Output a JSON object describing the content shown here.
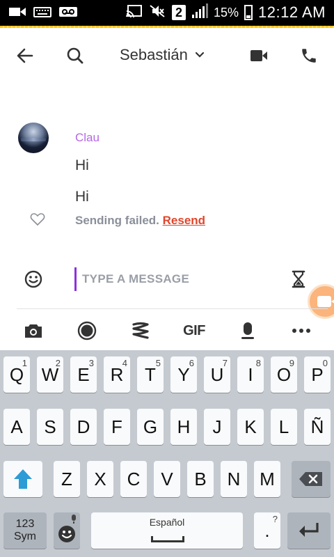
{
  "status_bar": {
    "sim_number": "2",
    "battery_percent": "15%",
    "time": "12:12 AM"
  },
  "header": {
    "contact_name": "Sebastián"
  },
  "conversation": {
    "sender_name": "Clau",
    "messages": [
      "Hi",
      "Hi"
    ],
    "failed_text": "Sending failed.",
    "resend_label": "Resend"
  },
  "composer": {
    "placeholder": "TYPE A MESSAGE"
  },
  "tools": {
    "gif_label": "GIF"
  },
  "keyboard": {
    "row1": [
      {
        "key": "Q",
        "hint": "1"
      },
      {
        "key": "W",
        "hint": "2"
      },
      {
        "key": "E",
        "hint": "3"
      },
      {
        "key": "R",
        "hint": "4"
      },
      {
        "key": "T",
        "hint": "5"
      },
      {
        "key": "Y",
        "hint": "6"
      },
      {
        "key": "U",
        "hint": "7"
      },
      {
        "key": "I",
        "hint": "8"
      },
      {
        "key": "O",
        "hint": "9"
      },
      {
        "key": "P",
        "hint": "0"
      }
    ],
    "row2": [
      "A",
      "S",
      "D",
      "F",
      "G",
      "H",
      "J",
      "K",
      "L",
      "Ñ"
    ],
    "row3": [
      "Z",
      "X",
      "C",
      "V",
      "B",
      "N",
      "M"
    ],
    "sym_top": "123",
    "sym_bottom": "Sym",
    "space_label": "Español",
    "period_label": ".",
    "period_hint": "?"
  },
  "colors": {
    "accent_purple": "#b667e5",
    "cursor_purple": "#8e2ee0",
    "resend_red": "#e0462b",
    "shift_blue": "#2d9bd6",
    "snap_yellow": "#f7c21e",
    "video_bubble": "#fbb47c"
  }
}
